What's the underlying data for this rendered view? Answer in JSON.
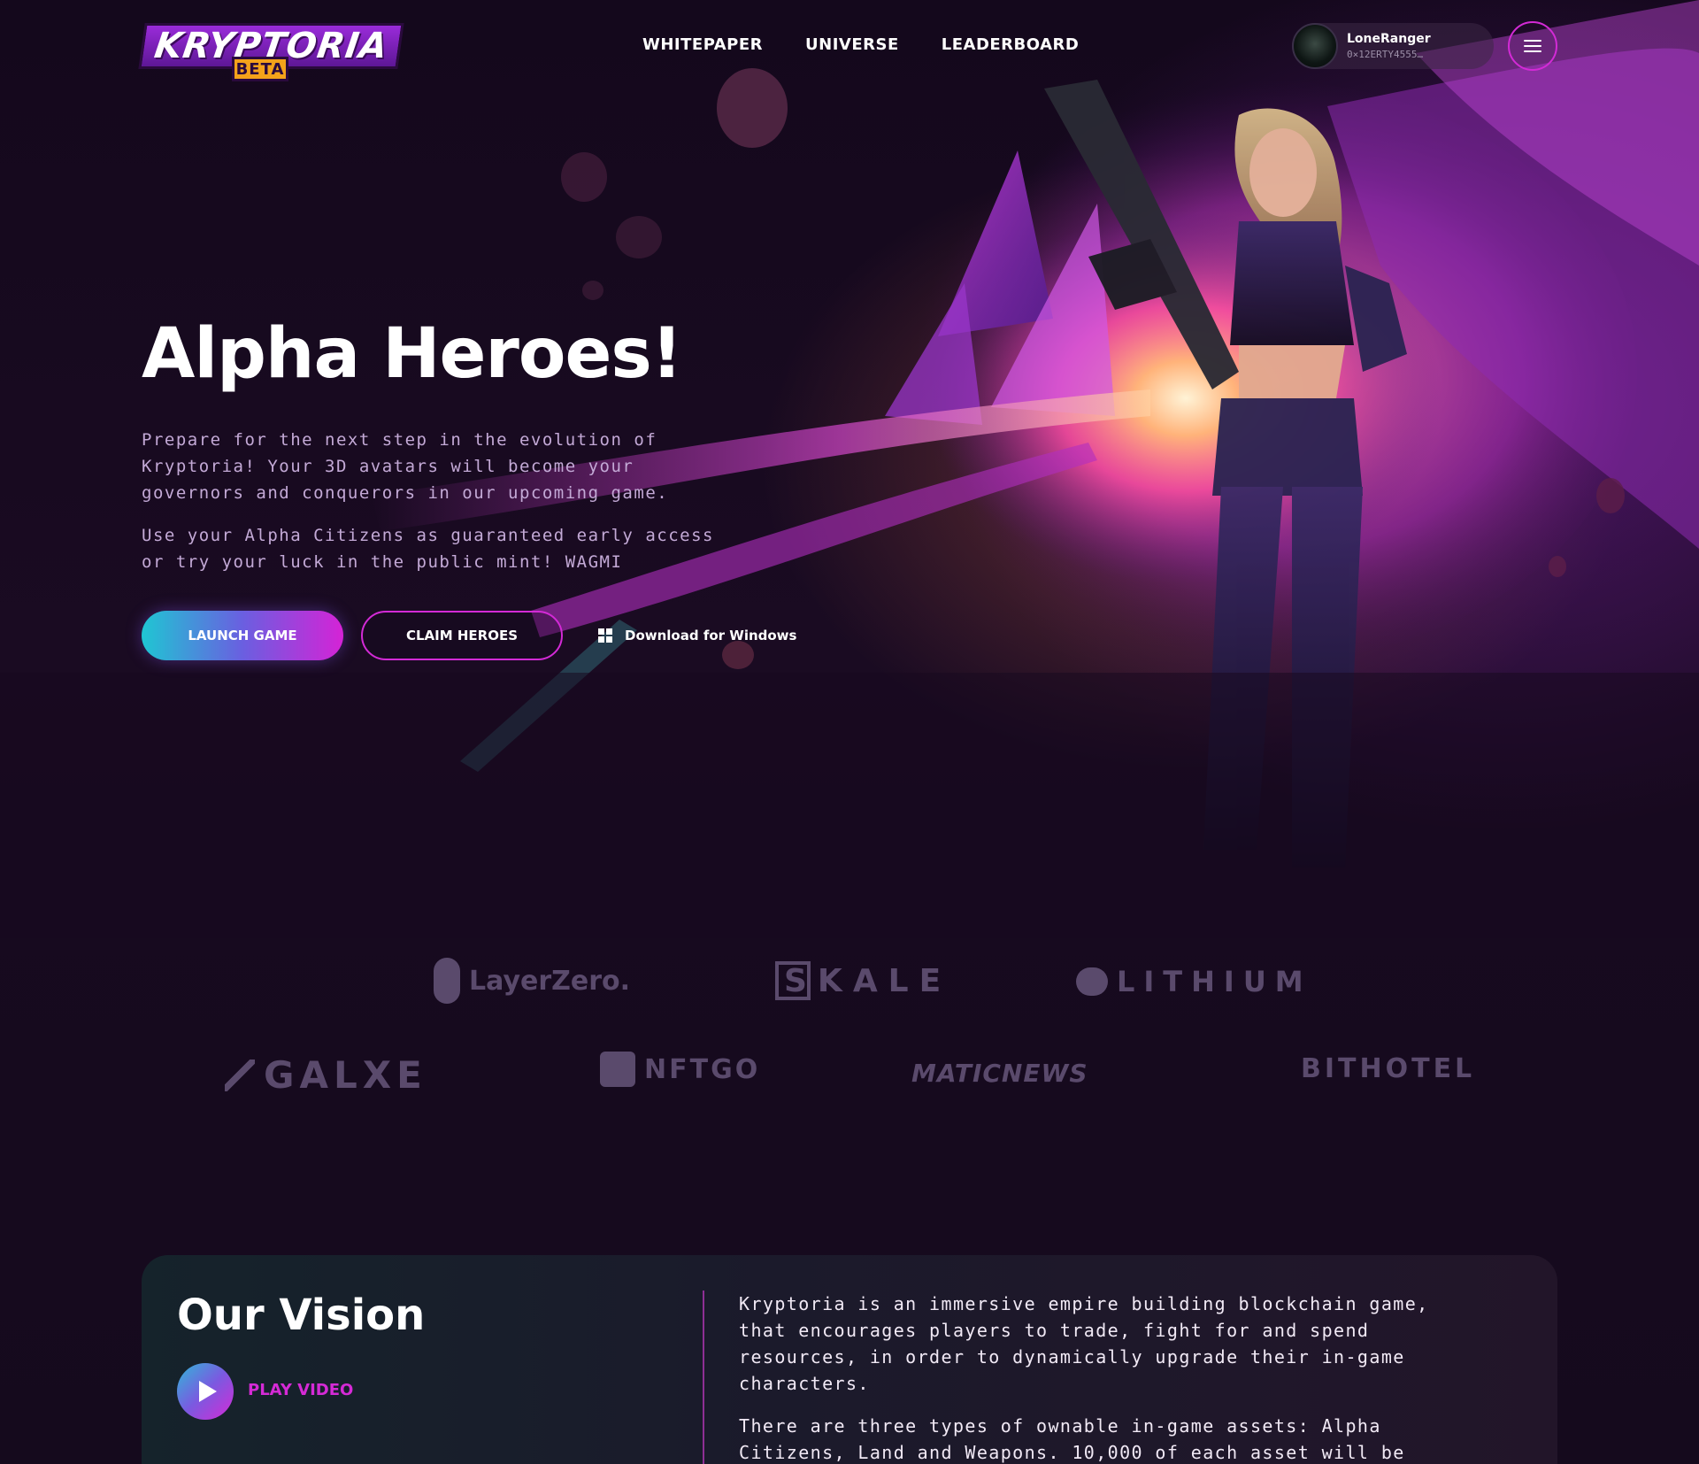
{
  "header": {
    "logo_text": "KRYPTORIA",
    "logo_badge": "BETA",
    "nav": [
      "WHITEPAPER",
      "UNIVERSE",
      "LEADERBOARD"
    ],
    "user": {
      "name": "LoneRanger",
      "wallet": "0×12ERTY4555…"
    }
  },
  "hero": {
    "title": "Alpha Heroes!",
    "paragraph_1": "Prepare for the next step in the evolution of Kryptoria! Your 3D avatars will become your governors and conquerors in our upcoming game.",
    "paragraph_2": "Use your Alpha Citizens as guaranteed early access or try your luck in the public mint! WAGMI",
    "buttons": {
      "launch": "LAUNCH GAME",
      "claim": "CLAIM HEROES",
      "download": "Download for Windows"
    }
  },
  "partners": [
    "LayerZero.",
    "SKALE",
    "LITHIUM",
    "GALXE",
    "NFTGO",
    "MATICNEWS",
    "BITHOTEL"
  ],
  "vision": {
    "title": "Our Vision",
    "play_label": "PLAY VIDEO",
    "paragraph_1": "Kryptoria is an immersive empire building blockchain game, that encourages players to trade, fight for and spend resources, in order to dynamically upgrade their in-game characters.",
    "paragraph_2": "There are three types of ownable in-game assets: Alpha Citizens, Land and Weapons. 10,000 of each asset will be"
  },
  "colors": {
    "accent_magenta": "#d52ad6",
    "accent_cyan": "#1fc6d3",
    "logo_badge": "#f4a21a",
    "background": "#150a1d"
  },
  "icons": [
    "windows-icon",
    "hamburger-menu-icon",
    "play-icon",
    "user-avatar"
  ]
}
